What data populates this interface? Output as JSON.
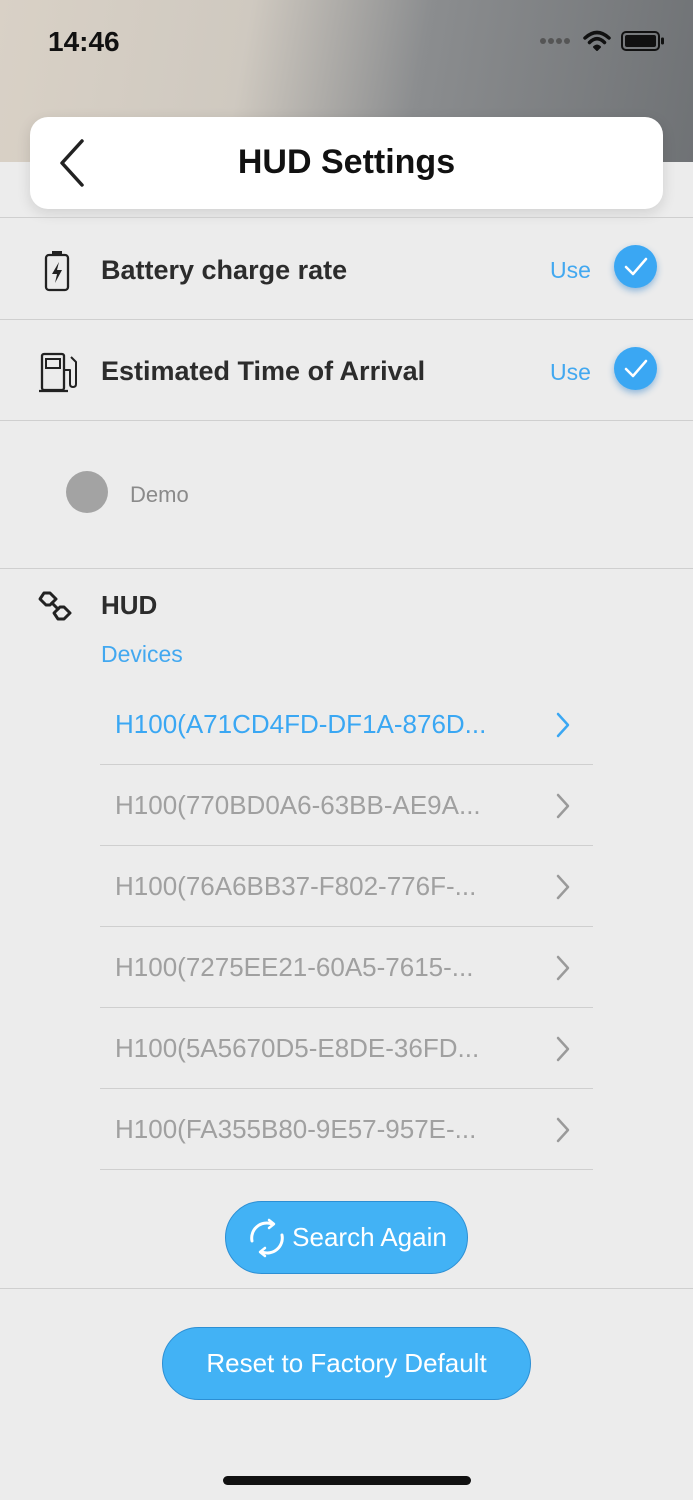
{
  "status_bar": {
    "time": "14:46",
    "signal_icon": "signal-dots-icon",
    "wifi_icon": "wifi-icon",
    "battery_icon": "battery-icon"
  },
  "header": {
    "title": "HUD Settings",
    "back_icon": "chevron-left-icon"
  },
  "settings": [
    {
      "label": "Battery charge rate",
      "use_label": "Use",
      "checked": true,
      "icon": "battery-charge-icon"
    },
    {
      "label": "Estimated Time of Arrival",
      "use_label": "Use",
      "checked": true,
      "icon": "fuel-pump-icon"
    }
  ],
  "demo": {
    "label": "Demo"
  },
  "hud": {
    "title": "HUD",
    "icon": "link-icon",
    "devices_label": "Devices",
    "devices": [
      {
        "name": "H100(A71CD4FD-DF1A-876D...",
        "active": true
      },
      {
        "name": "H100(770BD0A6-63BB-AE9A...",
        "active": false
      },
      {
        "name": "H100(76A6BB37-F802-776F-...",
        "active": false
      },
      {
        "name": "H100(7275EE21-60A5-7615-...",
        "active": false
      },
      {
        "name": "H100(5A5670D5-E8DE-36FD...",
        "active": false
      },
      {
        "name": "H100(FA355B80-9E57-957E-...",
        "active": false
      }
    ]
  },
  "search_again": {
    "label": "Search Again",
    "icon": "refresh-icon"
  },
  "reset": {
    "label": "Reset to Factory Default"
  },
  "colors": {
    "accent": "#42a8f0",
    "button": "#42b2f5",
    "inactive_text": "#a0a0a0"
  }
}
